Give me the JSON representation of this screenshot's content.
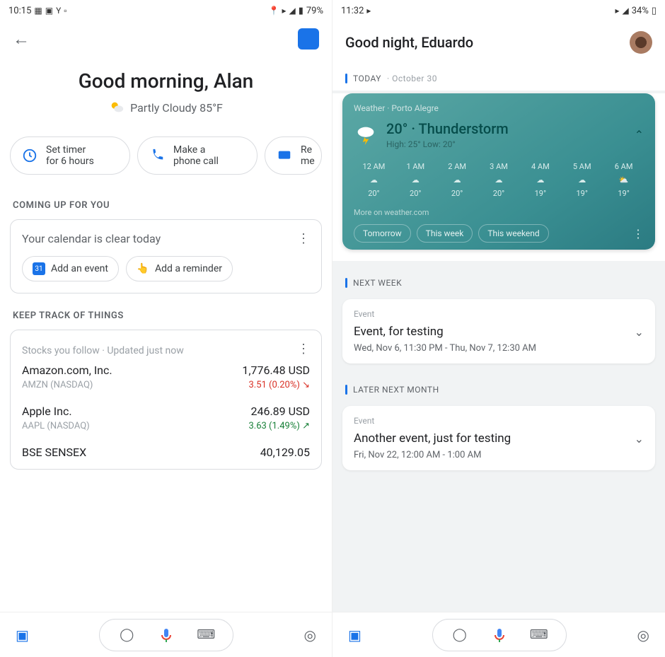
{
  "left": {
    "status": {
      "time": "10:15",
      "battery": "79%"
    },
    "greeting": "Good morning, Alan",
    "weather": {
      "cond": "Partly Cloudy 85°F"
    },
    "chips": [
      {
        "line1": "Set timer",
        "line2": "for 6 hours"
      },
      {
        "line1": "Make a",
        "line2": "phone call"
      },
      {
        "line1": "Re",
        "line2": "me"
      }
    ],
    "sec1": "COMING UP FOR YOU",
    "calendar": {
      "msg": "Your calendar is clear today",
      "add_event": "Add an event",
      "add_reminder": "Add a reminder"
    },
    "sec2": "KEEP TRACK OF THINGS",
    "stocks": {
      "header": "Stocks you follow · Updated just now",
      "rows": [
        {
          "name": "Amazon.com, Inc.",
          "sub": "AMZN (NASDAQ)",
          "price": "1,776.48 USD",
          "chg": "3.51 (0.20%) ↘",
          "dir": "down"
        },
        {
          "name": "Apple Inc.",
          "sub": "AAPL (NASDAQ)",
          "price": "246.89 USD",
          "chg": "3.63 (1.49%) ↗",
          "dir": "up"
        },
        {
          "name": "BSE SENSEX",
          "sub": "",
          "price": "40,129.05",
          "chg": "",
          "dir": ""
        }
      ]
    }
  },
  "right": {
    "status": {
      "time": "11:32",
      "battery": "34%"
    },
    "greeting": "Good night, Eduardo",
    "today_label": "TODAY",
    "today_date": "· October 30",
    "weather": {
      "loc": "Weather · Porto Alegre",
      "temp": "20° · Thunderstorm",
      "hl": "High: 25° Low: 20°",
      "hours": [
        {
          "t": "12 AM",
          "v": "20°"
        },
        {
          "t": "1 AM",
          "v": "20°"
        },
        {
          "t": "2 AM",
          "v": "20°"
        },
        {
          "t": "3 AM",
          "v": "20°"
        },
        {
          "t": "4 AM",
          "v": "19°"
        },
        {
          "t": "5 AM",
          "v": "19°"
        },
        {
          "t": "6 AM",
          "v": "19°"
        }
      ],
      "more": "More on weather.com",
      "chips": [
        "Tomorrow",
        "This week",
        "This weekend"
      ]
    },
    "sec_nextweek": "NEXT WEEK",
    "event1": {
      "label": "Event",
      "title": "Event, for testing",
      "date": "Wed, Nov 6, 11:30 PM - Thu, Nov 7, 12:30 AM"
    },
    "sec_later": "LATER NEXT MONTH",
    "event2": {
      "label": "Event",
      "title": "Another event, just for testing",
      "date": "Fri, Nov 22, 12:00 AM - 1:00 AM"
    }
  }
}
